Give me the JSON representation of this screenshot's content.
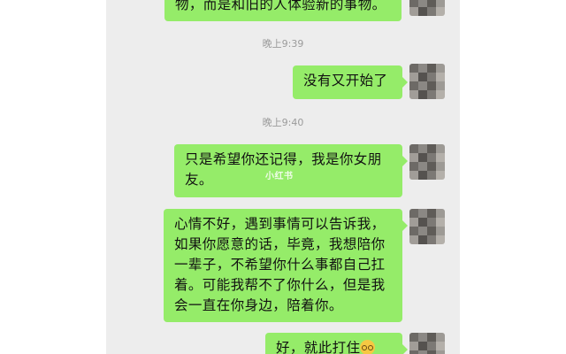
{
  "messages": [
    {
      "text_lines": [
        "物，而是和旧的人体验新的事物。"
      ]
    },
    {
      "timestamp": "晚上9:39"
    },
    {
      "text_lines": [
        "没有又开始了"
      ]
    },
    {
      "timestamp": "晚上9:40"
    },
    {
      "text_lines": [
        "只是希望你还记得，我是你女朋",
        "友。"
      ],
      "watermark": "小红书"
    },
    {
      "text_lines": [
        "心情不好，遇到事情可以告诉我，",
        "如果你愿意的话，毕竟，我想陪你",
        "一辈子，不希望你什么事都自己扛",
        "着。可能我帮不了你什么，但是我",
        "会一直在你身边，陪着你。"
      ]
    },
    {
      "text_lines": [
        "好，就此打住"
      ],
      "emoji": "grimace-emoji"
    }
  ],
  "colors": {
    "bubble": "#95ec69",
    "chat_background": "#ededed",
    "timestamp": "#9b9b9b"
  }
}
